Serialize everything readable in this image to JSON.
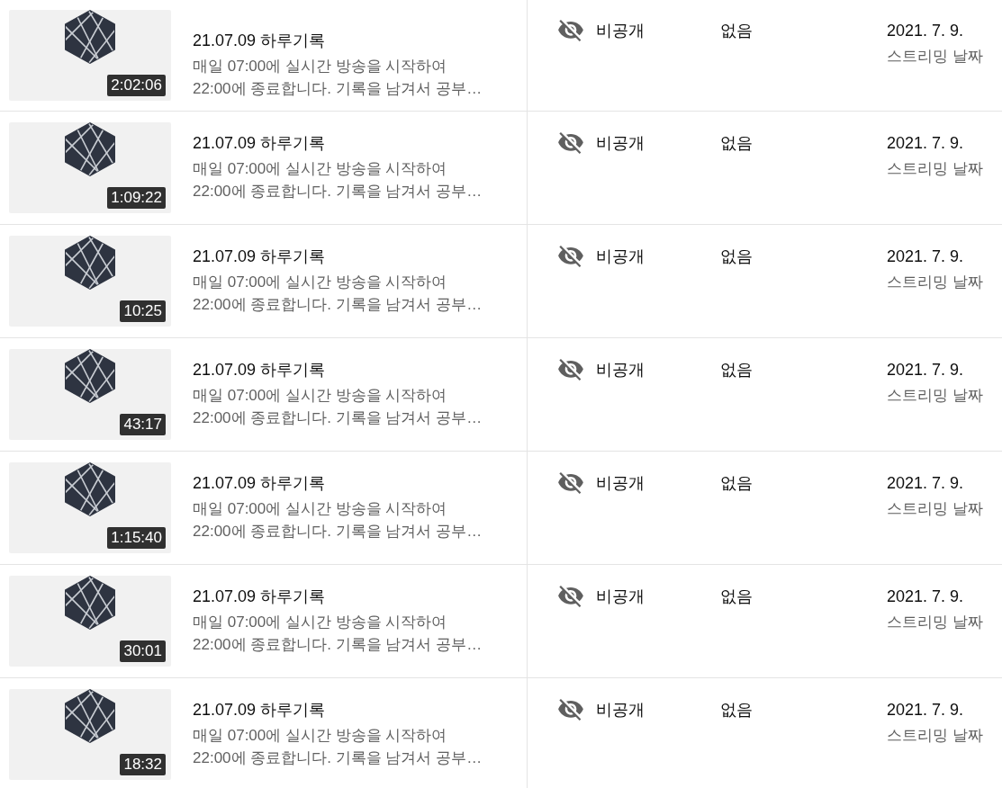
{
  "videos": [
    {
      "duration": "2:02:06",
      "title": "21.07.09 하루기록",
      "description": "매일 07:00에 실시간 방송을 시작하여\n22:00에 종료합니다. 기록을 남겨서 공부…",
      "visibility": "비공개",
      "restrictions": "없음",
      "date": "2021. 7. 9.",
      "date_label": "스트리밍 날짜"
    },
    {
      "duration": "1:09:22",
      "title": "21.07.09 하루기록",
      "description": "매일 07:00에 실시간 방송을 시작하여\n22:00에 종료합니다. 기록을 남겨서 공부…",
      "visibility": "비공개",
      "restrictions": "없음",
      "date": "2021. 7. 9.",
      "date_label": "스트리밍 날짜"
    },
    {
      "duration": "10:25",
      "title": "21.07.09 하루기록",
      "description": "매일 07:00에 실시간 방송을 시작하여\n22:00에 종료합니다. 기록을 남겨서 공부…",
      "visibility": "비공개",
      "restrictions": "없음",
      "date": "2021. 7. 9.",
      "date_label": "스트리밍 날짜"
    },
    {
      "duration": "43:17",
      "title": "21.07.09 하루기록",
      "description": "매일 07:00에 실시간 방송을 시작하여\n22:00에 종료합니다. 기록을 남겨서 공부…",
      "visibility": "비공개",
      "restrictions": "없음",
      "date": "2021. 7. 9.",
      "date_label": "스트리밍 날짜"
    },
    {
      "duration": "1:15:40",
      "title": "21.07.09 하루기록",
      "description": "매일 07:00에 실시간 방송을 시작하여\n22:00에 종료합니다. 기록을 남겨서 공부…",
      "visibility": "비공개",
      "restrictions": "없음",
      "date": "2021. 7. 9.",
      "date_label": "스트리밍 날짜"
    },
    {
      "duration": "30:01",
      "title": "21.07.09 하루기록",
      "description": "매일 07:00에 실시간 방송을 시작하여\n22:00에 종료합니다. 기록을 남겨서 공부…",
      "visibility": "비공개",
      "restrictions": "없음",
      "date": "2021. 7. 9.",
      "date_label": "스트리밍 날짜"
    },
    {
      "duration": "18:32",
      "title": "21.07.09 하루기록",
      "description": "매일 07:00에 실시간 방송을 시작하여\n22:00에 종료합니다. 기록을 남겨서 공부…",
      "visibility": "비공개",
      "restrictions": "없음",
      "date": "2021. 7. 9.",
      "date_label": "스트리밍 날짜"
    }
  ]
}
